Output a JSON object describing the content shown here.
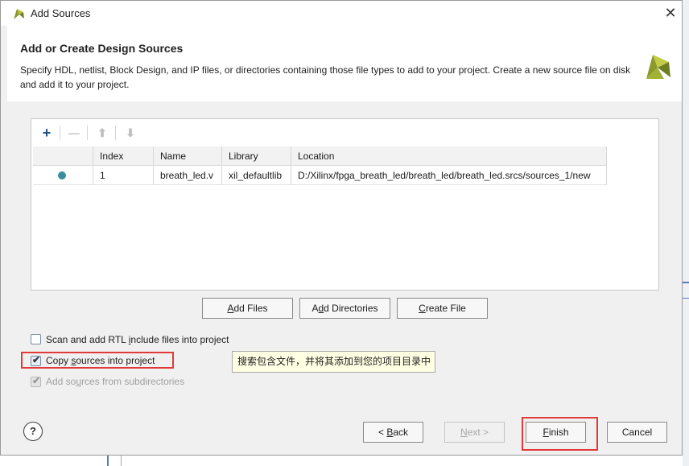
{
  "window": {
    "title": "Add Sources"
  },
  "header": {
    "title": "Add or Create Design Sources",
    "description": "Specify HDL, netlist, Block Design, and IP files, or directories containing those file types to add to your project. Create a new source file on disk and add it to your project."
  },
  "toolbar": {
    "add": "+",
    "remove": "—",
    "up": "⬆",
    "down": "⬇"
  },
  "table": {
    "columns": [
      "",
      "Index",
      "Name",
      "Library",
      "Location"
    ],
    "rows": [
      {
        "index": "1",
        "name": "breath_led.v",
        "library": "xil_defaultlib",
        "location": "D:/Xilinx/fpga_breath_led/breath_led/breath_led.srcs/sources_1/new"
      }
    ]
  },
  "buttons": {
    "add_files": {
      "mn": "A",
      "rest": "dd Files"
    },
    "add_directories": {
      "pre": "A",
      "mn": "d",
      "rest": "d Directories"
    },
    "create_file": {
      "mn": "C",
      "rest": "reate File"
    },
    "back": {
      "pre": "< ",
      "mn": "B",
      "rest": "ack"
    },
    "next": {
      "mn": "N",
      "rest": "ext >"
    },
    "finish": {
      "mn": "F",
      "rest": "inish"
    },
    "cancel": "Cancel"
  },
  "options": {
    "scan_rtl": {
      "pre": "Scan and add RTL ",
      "mn": "i",
      "rest": "nclude files into project",
      "checked": false
    },
    "copy_sources": {
      "pre": "Copy ",
      "mn": "s",
      "rest": "ources into project",
      "checked": true
    },
    "add_subdirs": {
      "pre": "Add so",
      "mn": "u",
      "rest": "rces from subdirectories",
      "checked": true,
      "disabled": true
    }
  },
  "tooltip": "搜索包含文件，并将其添加到您的项目目录中",
  "help": "?",
  "colors": {
    "accent": "#3a8ea0",
    "highlight": "#e23a3a",
    "logo": "#8a9a2a"
  }
}
